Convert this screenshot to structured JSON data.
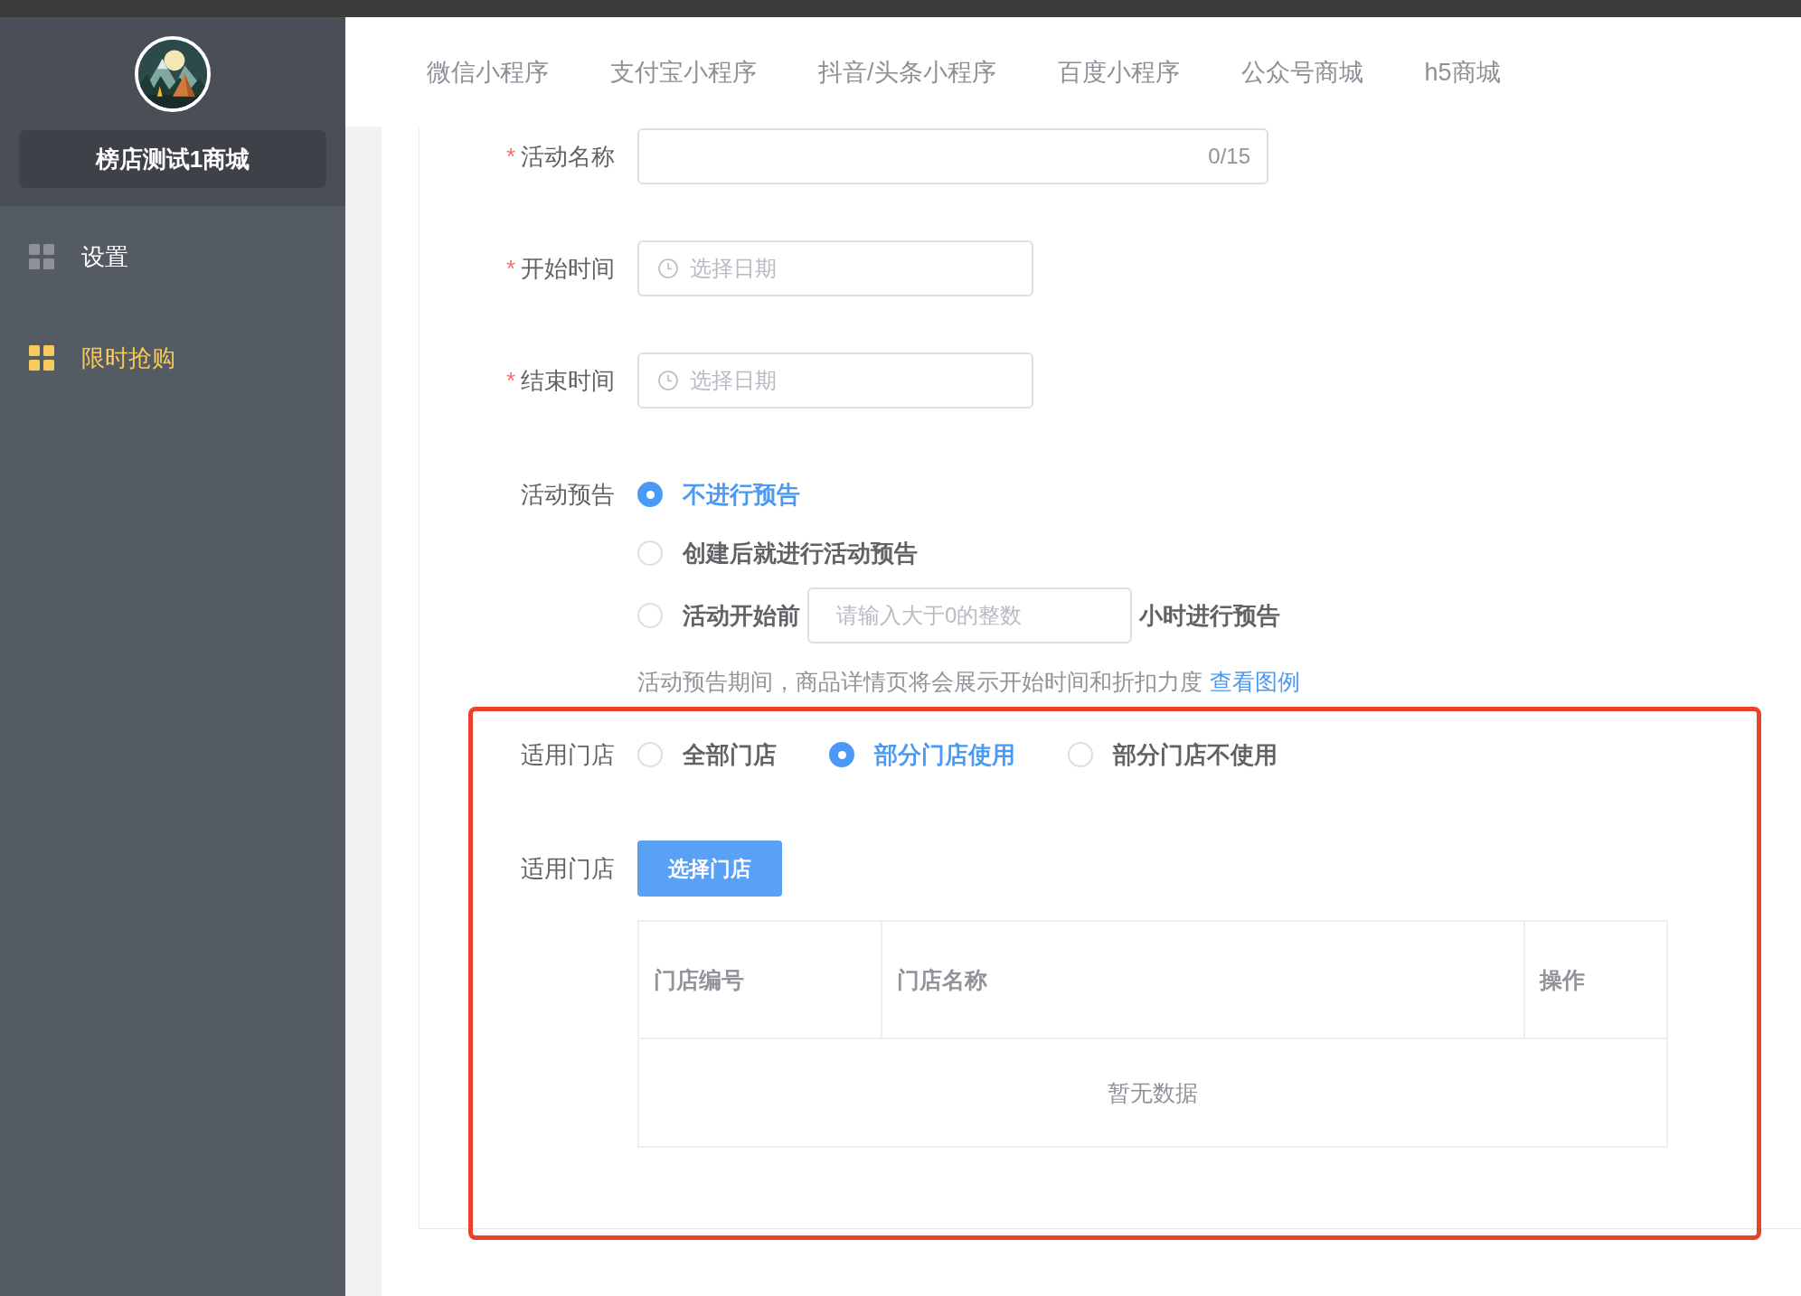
{
  "sidebar": {
    "shop_name": "榜店测试1商城",
    "items": [
      {
        "label": "设置",
        "selected": false
      },
      {
        "label": "限时抢购",
        "selected": true
      }
    ]
  },
  "tabs": [
    {
      "label": "微信小程序"
    },
    {
      "label": "支付宝小程序"
    },
    {
      "label": "抖音/头条小程序"
    },
    {
      "label": "百度小程序"
    },
    {
      "label": "公众号商城"
    },
    {
      "label": "h5商城"
    }
  ],
  "form": {
    "activity_name": {
      "required_mark": "*",
      "label": "活动名称",
      "counter": "0/15"
    },
    "start_time": {
      "required_mark": "*",
      "label": "开始时间",
      "placeholder": "选择日期"
    },
    "end_time": {
      "required_mark": "*",
      "label": "结束时间",
      "placeholder": "选择日期"
    },
    "preview": {
      "label": "活动预告",
      "options": [
        {
          "kind": "plain",
          "label": "不进行预告",
          "selected": true
        },
        {
          "kind": "plain",
          "label": "创建后就进行活动预告",
          "selected": false
        },
        {
          "kind": "hours",
          "label": "活动开始前",
          "placeholder": "请输入大于0的整数",
          "suffix": "小时进行预告",
          "selected": false
        }
      ],
      "hint": "活动预告期间，商品详情页将会展示开始时间和折扣力度",
      "hint_link": "查看图例"
    },
    "store_scope": {
      "label": "适用门店",
      "options": [
        {
          "label": "全部门店",
          "selected": false
        },
        {
          "label": "部分门店使用",
          "selected": true
        },
        {
          "label": "部分门店不使用",
          "selected": false
        }
      ]
    },
    "store_select": {
      "label": "适用门店",
      "button": "选择门店",
      "table": {
        "columns": [
          "门店编号",
          "门店名称",
          "操作"
        ],
        "empty_text": "暂无数据"
      }
    }
  }
}
